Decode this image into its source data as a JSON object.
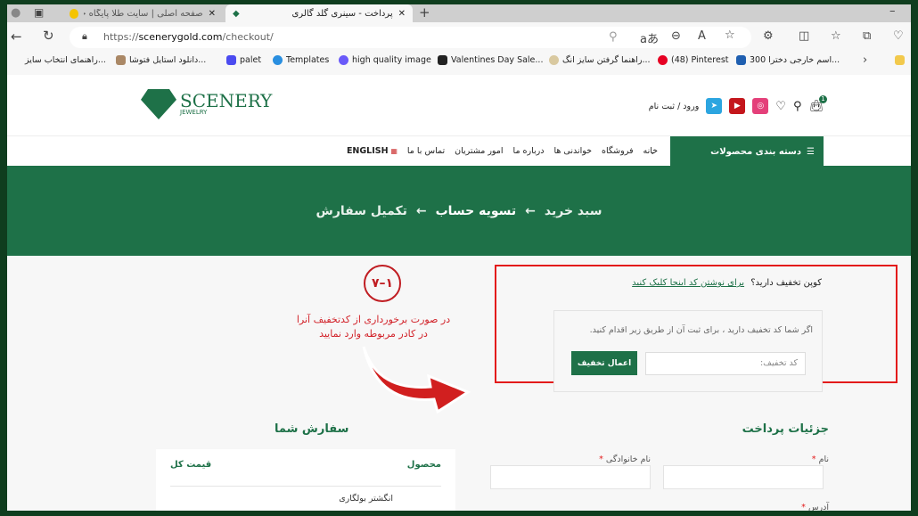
{
  "browser": {
    "tabs": [
      {
        "title": "صفحه اصلی | سایت طلا پایگاه خبری"
      },
      {
        "title": "پرداخت - سینری گلد گالری",
        "active": true
      }
    ],
    "url_prefix": "https://",
    "url_domain": "scenerygold.com",
    "url_path": "/checkout/",
    "bookmarks": [
      "راهنمای انتخاب سایز...",
      "دانلود استایل فتوشا...",
      "palet",
      "Templates",
      "high quality image",
      "Valentines Day Sale...",
      "راهنما گرفتن سایز انگ...",
      "(48) Pinterest",
      "300 اسم خارجی دخترا..."
    ]
  },
  "header": {
    "logo_text": "SCENERY",
    "logo_sub": "JEWELRY",
    "login": "ورود / ثبت نام",
    "cart_count": "1",
    "categories_label": "دسته بندی محصولات",
    "nav": [
      "خانه",
      "فروشگاه",
      "خواندنی ها",
      "درباره ما",
      "امور مشتریان",
      "تماس با ما",
      "ENGLISH"
    ]
  },
  "breadcrumb": {
    "steps": [
      "سبد خرید",
      "تسویه حساب",
      "تکمیل سفارش"
    ],
    "separator": "←"
  },
  "coupon": {
    "question": "کوپن تخفیف دارید؟",
    "link": "برای نوشتن کد اینجا کلیک کنید",
    "description": "اگر شما کد تخفیف دارید ، برای ثبت آن از طریق زیر اقدام کنید.",
    "placeholder": "کد تخفیف:",
    "apply": "اعمال تخفیف"
  },
  "annotation": {
    "step": "۷–۱",
    "text": "در صورت برخورداری از کدتخفیف آنرا در کادر مربوطه وارد نمایید",
    "color": "#d2232a"
  },
  "order": {
    "title": "سفارش شما",
    "col_product": "محصول",
    "col_total": "قیمت کل",
    "product": "انگشتر بولگاری"
  },
  "billing": {
    "title": "جزئیات پرداخت",
    "first_name": "نام",
    "last_name": "نام خانوادگی",
    "address": "آدرس",
    "required": "*"
  },
  "colors": {
    "brand": "#1e7148",
    "highlight": "#e31b1b"
  }
}
